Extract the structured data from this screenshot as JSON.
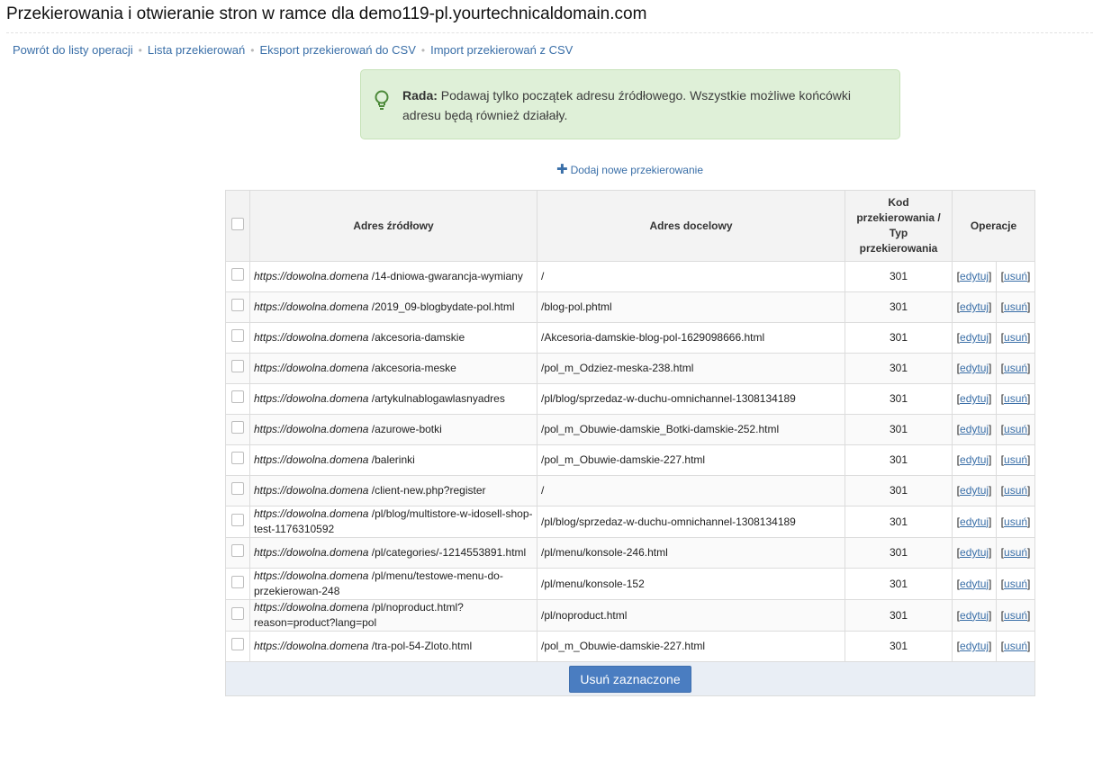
{
  "page": {
    "title": "Przekierowania i otwieranie stron w ramce dla demo119-pl.yourtechnicaldomain.com"
  },
  "nav": {
    "back": "Powrót do listy operacji",
    "list": "Lista przekierowań",
    "export": "Eksport przekierowań do CSV",
    "import": "Import przekierowań z CSV"
  },
  "tip": {
    "label": "Rada:",
    "text": " Podawaj tylko początek adresu źródłowego. Wszystkie możliwe końcówki adresu będą również działały."
  },
  "add_link": "Dodaj nowe przekierowanie",
  "table": {
    "headers": {
      "source": "Adres źródłowy",
      "target": "Adres docelowy",
      "code_line1": "Kod",
      "code_line2": "przekierowania /",
      "code_line3": "Typ",
      "code_line4": "przekierowania",
      "operations": "Operacje"
    },
    "domain_prefix": "https://dowolna.domena",
    "edit_label": "edytuj",
    "delete_label": "usuń",
    "rows": [
      {
        "source": " /14-dniowa-gwarancja-wymiany",
        "target": "/",
        "code": "301"
      },
      {
        "source": " /2019_09-blogbydate-pol.html",
        "target": "/blog-pol.phtml",
        "code": "301"
      },
      {
        "source": " /akcesoria-damskie",
        "target": "/Akcesoria-damskie-blog-pol-1629098666.html",
        "code": "301"
      },
      {
        "source": " /akcesoria-meske",
        "target": "/pol_m_Odziez-meska-238.html",
        "code": "301"
      },
      {
        "source": " /artykulnablogawlasnyadres",
        "target": "/pl/blog/sprzedaz-w-duchu-omnichannel-1308134189",
        "code": "301"
      },
      {
        "source": " /azurowe-botki",
        "target": "/pol_m_Obuwie-damskie_Botki-damskie-252.html",
        "code": "301"
      },
      {
        "source": " /balerinki",
        "target": "/pol_m_Obuwie-damskie-227.html",
        "code": "301"
      },
      {
        "source": " /client-new.php?register",
        "target": "/",
        "code": "301"
      },
      {
        "source": " /pl/blog/multistore-w-idosell-shop-test-1176310592",
        "target": "/pl/blog/sprzedaz-w-duchu-omnichannel-1308134189",
        "code": "301"
      },
      {
        "source": " /pl/categories/-1214553891.html",
        "target": "/pl/menu/konsole-246.html",
        "code": "301"
      },
      {
        "source": " /pl/menu/testowe-menu-do-przekierowan-248",
        "target": "/pl/menu/konsole-152",
        "code": "301"
      },
      {
        "source": " /pl/noproduct.html?reason=product?lang=pol",
        "target": "/pl/noproduct.html",
        "code": "301"
      },
      {
        "source": " /tra-pol-54-Zloto.html",
        "target": "/pol_m_Obuwie-damskie-227.html",
        "code": "301"
      }
    ]
  },
  "delete_selected": "Usuń zaznaczone",
  "colors": {
    "link": "#3a6fa8",
    "tip_bg": "#dff0d8",
    "button_bg": "#4a7dc1"
  }
}
